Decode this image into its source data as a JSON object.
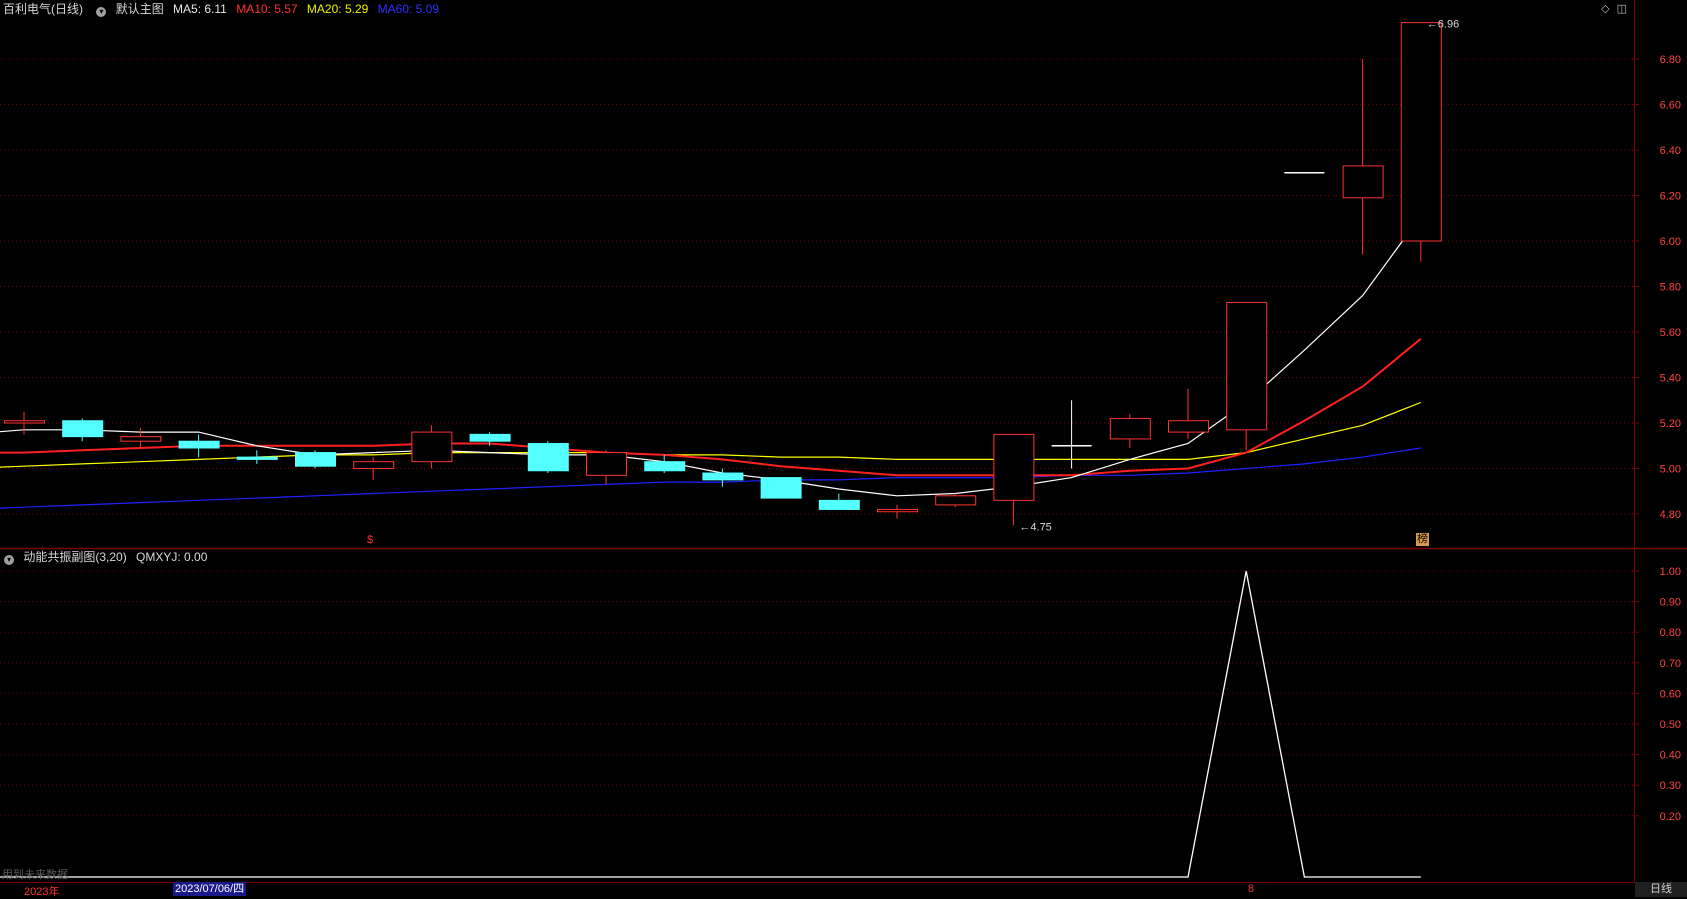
{
  "main_header": {
    "stock": "百利电气(日线)",
    "template": "默认主图",
    "ma5": "MA5: 6.11",
    "ma10": "MA10: 5.57",
    "ma20": "MA20: 5.29",
    "ma60": "MA60: 5.09"
  },
  "sub_header": {
    "indicator": "动能共振副图(3,20)",
    "value": "QMXYJ: 0.00"
  },
  "bottom_bar": {
    "year": "2023年",
    "cursor_date": "2023/07/06/四",
    "tick_8": "8",
    "period": "日线",
    "ghost_text": "用到未来数据"
  },
  "markers": {
    "s_mark": "$",
    "bang": "榜"
  },
  "colors": {
    "up": "#ff3232",
    "down": "#54ffff",
    "ma5": "#ffffff",
    "ma10": "#ff2020",
    "ma20": "#ffff00",
    "ma60": "#2020ff",
    "grid": "#7a0000",
    "axis_text": "#ff4040"
  },
  "chart_data": [
    {
      "type": "candlestick",
      "title": "百利电气(日线)",
      "ylim": [
        4.67,
        6.98
      ],
      "y_ticks": [
        "6.80",
        "6.60",
        "6.40",
        "6.20",
        "6.00",
        "5.80",
        "5.60",
        "5.40",
        "5.20",
        "5.00",
        "4.80"
      ],
      "candles": [
        {
          "o": 5.2,
          "h": 5.25,
          "l": 5.15,
          "c": 5.21
        },
        {
          "o": 5.21,
          "h": 5.22,
          "l": 5.12,
          "c": 5.14
        },
        {
          "o": 5.12,
          "h": 5.18,
          "l": 5.09,
          "c": 5.14
        },
        {
          "o": 5.12,
          "h": 5.15,
          "l": 5.05,
          "c": 5.09
        },
        {
          "o": 5.05,
          "h": 5.08,
          "l": 5.02,
          "c": 5.04
        },
        {
          "o": 5.07,
          "h": 5.08,
          "l": 5.0,
          "c": 5.01
        },
        {
          "o": 5.0,
          "h": 5.05,
          "l": 4.95,
          "c": 5.03
        },
        {
          "o": 5.03,
          "h": 5.19,
          "l": 5.0,
          "c": 5.16
        },
        {
          "o": 5.15,
          "h": 5.16,
          "l": 5.1,
          "c": 5.12
        },
        {
          "o": 5.11,
          "h": 5.12,
          "l": 4.98,
          "c": 4.99
        },
        {
          "o": 4.97,
          "h": 5.08,
          "l": 4.93,
          "c": 5.07
        },
        {
          "o": 5.03,
          "h": 5.06,
          "l": 4.98,
          "c": 4.99
        },
        {
          "o": 4.98,
          "h": 5.0,
          "l": 4.92,
          "c": 4.95
        },
        {
          "o": 4.96,
          "h": 4.96,
          "l": 4.87,
          "c": 4.87
        },
        {
          "o": 4.86,
          "h": 4.89,
          "l": 4.82,
          "c": 4.82
        },
        {
          "o": 4.81,
          "h": 4.84,
          "l": 4.78,
          "c": 4.82
        },
        {
          "o": 4.84,
          "h": 4.89,
          "l": 4.83,
          "c": 4.88
        },
        {
          "o": 4.86,
          "h": 5.15,
          "l": 4.75,
          "c": 5.15
        },
        {
          "o": 5.1,
          "h": 5.3,
          "l": 5.0,
          "c": 5.1
        },
        {
          "o": 5.13,
          "h": 5.24,
          "l": 5.09,
          "c": 5.22
        },
        {
          "o": 5.16,
          "h": 5.35,
          "l": 5.13,
          "c": 5.21
        },
        {
          "o": 5.17,
          "h": 5.73,
          "l": 5.08,
          "c": 5.73
        },
        {
          "o": 6.3,
          "h": 6.3,
          "l": 6.3,
          "c": 6.3
        },
        {
          "o": 6.19,
          "h": 6.8,
          "l": 5.94,
          "c": 6.33
        },
        {
          "o": 6.0,
          "h": 6.96,
          "l": 5.91,
          "c": 6.96
        }
      ],
      "ma5": [
        5.15,
        5.17,
        5.17,
        5.16,
        5.16,
        5.1,
        5.06,
        5.07,
        5.08,
        5.07,
        5.06,
        5.06,
        5.03,
        4.98,
        4.95,
        4.91,
        4.88,
        4.89,
        4.92,
        4.96,
        5.04,
        5.11,
        5.29,
        5.52,
        5.76,
        6.11
      ],
      "ma10": [
        5.07,
        5.07,
        5.08,
        5.09,
        5.1,
        5.1,
        5.1,
        5.1,
        5.11,
        5.11,
        5.09,
        5.07,
        5.06,
        5.04,
        5.01,
        4.99,
        4.97,
        4.97,
        4.97,
        4.97,
        4.99,
        5.0,
        5.07,
        5.21,
        5.36,
        5.57
      ],
      "ma20": [
        5.0,
        5.01,
        5.02,
        5.03,
        5.04,
        5.05,
        5.06,
        5.06,
        5.07,
        5.07,
        5.07,
        5.07,
        5.06,
        5.06,
        5.05,
        5.05,
        5.04,
        5.04,
        5.04,
        5.04,
        5.04,
        5.04,
        5.07,
        5.13,
        5.19,
        5.29
      ],
      "ma60": [
        4.82,
        4.83,
        4.84,
        4.85,
        4.86,
        4.87,
        4.88,
        4.89,
        4.9,
        4.91,
        4.92,
        4.93,
        4.94,
        4.94,
        4.95,
        4.95,
        4.96,
        4.96,
        4.96,
        4.97,
        4.97,
        4.98,
        5.0,
        5.02,
        5.05,
        5.09
      ],
      "annotations": [
        {
          "label": "4.75",
          "index": 17,
          "value": 4.75
        },
        {
          "label": "6.96",
          "index": 24,
          "value": 6.96
        }
      ]
    },
    {
      "type": "line",
      "title": "动能共振副图(3,20)",
      "series_name": "QMXYJ",
      "ylim": [
        0,
        1.05
      ],
      "y_ticks": [
        "1.00",
        "0.90",
        "0.80",
        "0.70",
        "0.60",
        "0.50",
        "0.40",
        "0.30",
        "0.20"
      ],
      "values": [
        0,
        0,
        0,
        0,
        0,
        0,
        0,
        0,
        0,
        0,
        0,
        0,
        0,
        0,
        0,
        0,
        0,
        0,
        0,
        0,
        0,
        0,
        1,
        0,
        0,
        0
      ]
    }
  ]
}
